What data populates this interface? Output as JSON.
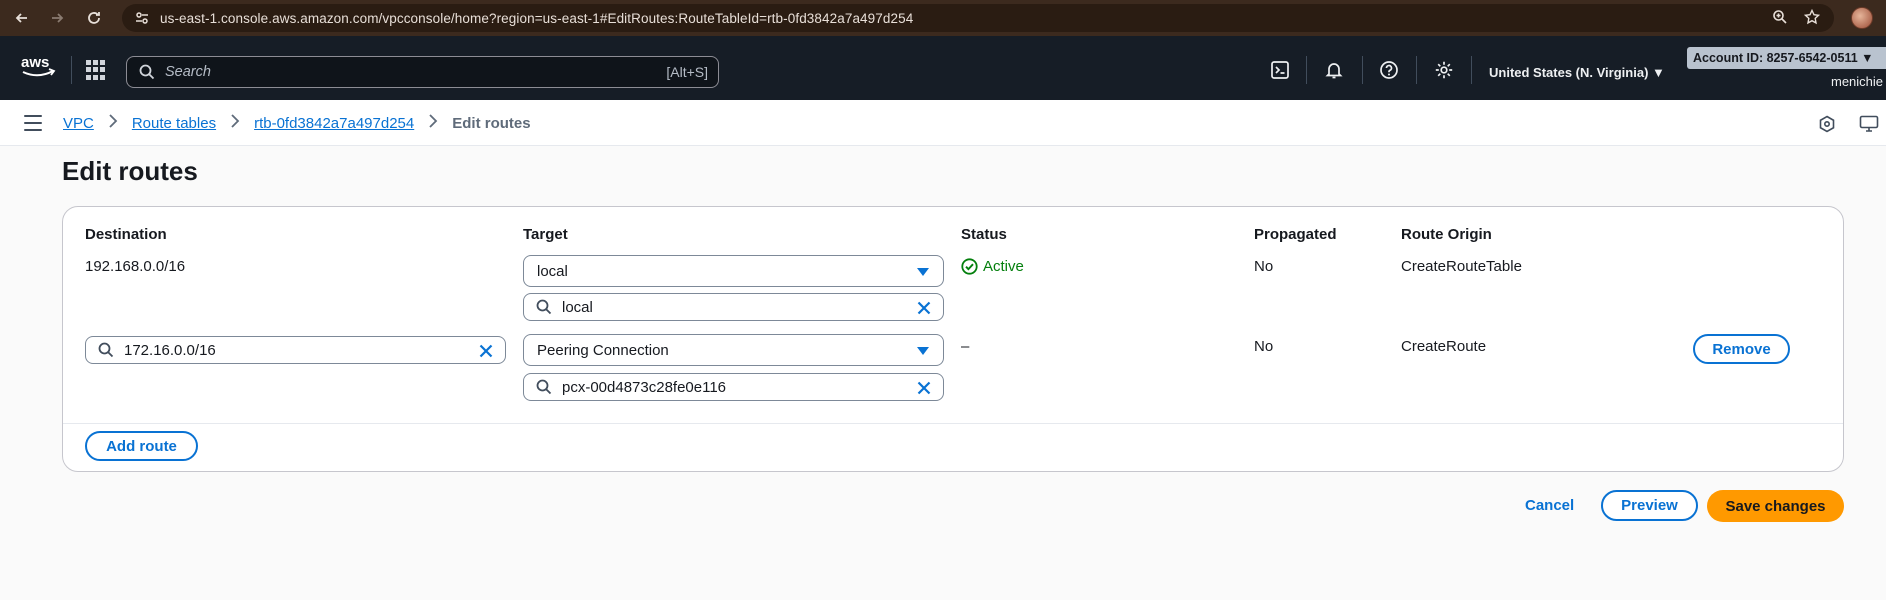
{
  "browser": {
    "url": "us-east-1.console.aws.amazon.com/vpcconsole/home?region=us-east-1#EditRoutes:RouteTableId=rtb-0fd3842a7a497d254"
  },
  "aws_nav": {
    "search_placeholder": "Search",
    "search_shortcut": "[Alt+S]",
    "region": "United States (N. Virginia) ▼",
    "account": "Account ID: 8257-6542-0511 ▼",
    "username": "menichie"
  },
  "breadcrumb": {
    "items": [
      "VPC",
      "Route tables",
      "rtb-0fd3842a7a497d254"
    ],
    "current": "Edit routes"
  },
  "page": {
    "title": "Edit routes"
  },
  "routes_table": {
    "headers": {
      "destination": "Destination",
      "target": "Target",
      "status": "Status",
      "propagated": "Propagated",
      "route_origin": "Route Origin"
    },
    "rows": [
      {
        "destination": "192.168.0.0/16",
        "target_type": "local",
        "target_value": "local",
        "status": "Active",
        "propagated": "No",
        "route_origin": "CreateRouteTable"
      },
      {
        "destination": "172.16.0.0/16",
        "target_type": "Peering Connection",
        "target_value": "pcx-00d4873c28fe0e116",
        "status": "–",
        "propagated": "No",
        "route_origin": "CreateRoute",
        "remove_label": "Remove"
      }
    ],
    "add_route_label": "Add route"
  },
  "actions": {
    "cancel": "Cancel",
    "preview": "Preview",
    "save": "Save changes"
  },
  "colors": {
    "accent": "#0972d3",
    "primary_button": "#ff9900",
    "status_active": "#037f0c",
    "nav_bg": "#161d26"
  }
}
